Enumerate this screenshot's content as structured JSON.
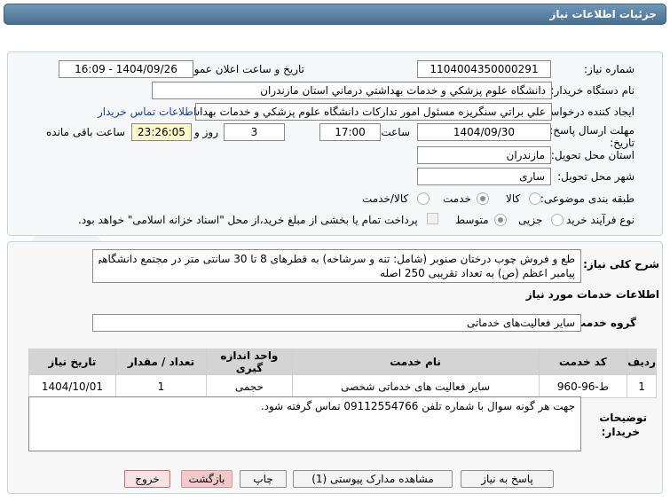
{
  "window": {
    "title": "جزئیات اطلاعات نیاز"
  },
  "watermark": {
    "text": "AriaTender.net"
  },
  "form": {
    "need_number_label": "شماره نیاز:",
    "need_number": "1104004350000291",
    "announce_label": "تاریخ و ساعت اعلان عمومی:",
    "announce_value": "1404/09/26 - 16:09",
    "buyer_org_label": "نام دستگاه خریدار:",
    "buyer_org": "دانشگاه علوم پزشكي و خدمات بهداشتي  درماني استان مازندران",
    "creator_label": "ایجاد کننده درخواست:",
    "creator": "علي براتي سنگريزه مسئول امور تداركات دانشگاه علوم پزشكي و خدمات بهداشتي",
    "contact_link": "اطلاعات تماس خریدار",
    "deadline_label": "مهلت ارسال پاسخ: تا تاریخ:",
    "deadline_date": "1404/09/30",
    "time_label": "ساعت",
    "deadline_time": "17:00",
    "days_value": "3",
    "days_label": "روز و",
    "remaining_time": "23:26:05",
    "remaining_label": "ساعت باقی مانده",
    "province_label": "استان محل تحویل:",
    "province": "مازندران",
    "city_label": "شهر محل تحویل:",
    "city": "ساری",
    "category_label": "طبقه بندی موضوعی:",
    "category_options": [
      "کالا",
      "خدمت",
      "کالا/خدمت"
    ],
    "category_selected": "خدمت",
    "process_label": "نوع فرآیند خرید :",
    "process_options": [
      "جزیی",
      "متوسط"
    ],
    "process_selected": "متوسط",
    "treasury_note": "پرداخت تمام یا بخشی از مبلغ خرید،از محل \"اسناد خزانه اسلامی\" خواهد بود."
  },
  "description": {
    "label": "شرح کلی نیاز:",
    "line1": "طع و فروش چوب درختان صنوبر (شامل: تنه و سرشاخه) به قطرهای 8 تا 30 سانتی متر در مجتمع دانشگاهی",
    "line2": "پیامبر اعظم (ص) به تعداد تقریبی 250 اصله"
  },
  "services": {
    "section_title": "اطلاعات خدمات مورد نیاز",
    "group_label": "گروه خدمت:",
    "group_value": "سایر فعالیت‌های خدماتی",
    "columns": [
      "ردیف",
      "کد خدمت",
      "نام خدمت",
      "واحد اندازه گیری",
      "تعداد / مقدار",
      "تاریخ نیاز"
    ],
    "rows": [
      [
        "1",
        "ط-96-960",
        "سایر فعالیت های خدماتی شخصی",
        "حجمی",
        "1",
        "1404/10/01"
      ]
    ]
  },
  "buyer_notes": {
    "label_line1": "توضیحات",
    "label_line2": "خریدار:",
    "text": "جهت هر گونه سوال با شماره تلفن 09112554766 تماس گرفته شود."
  },
  "buttons": {
    "reply": "پاسخ به نیاز",
    "attachments": "مشاهده مدارک پیوستی (1)",
    "print": "چاپ",
    "back": "بازگشت",
    "exit": "خروج"
  },
  "colors": {
    "title_bar": "#5a82a3",
    "link": "#1144aa",
    "remaining_bg": "#fbf7c6"
  }
}
